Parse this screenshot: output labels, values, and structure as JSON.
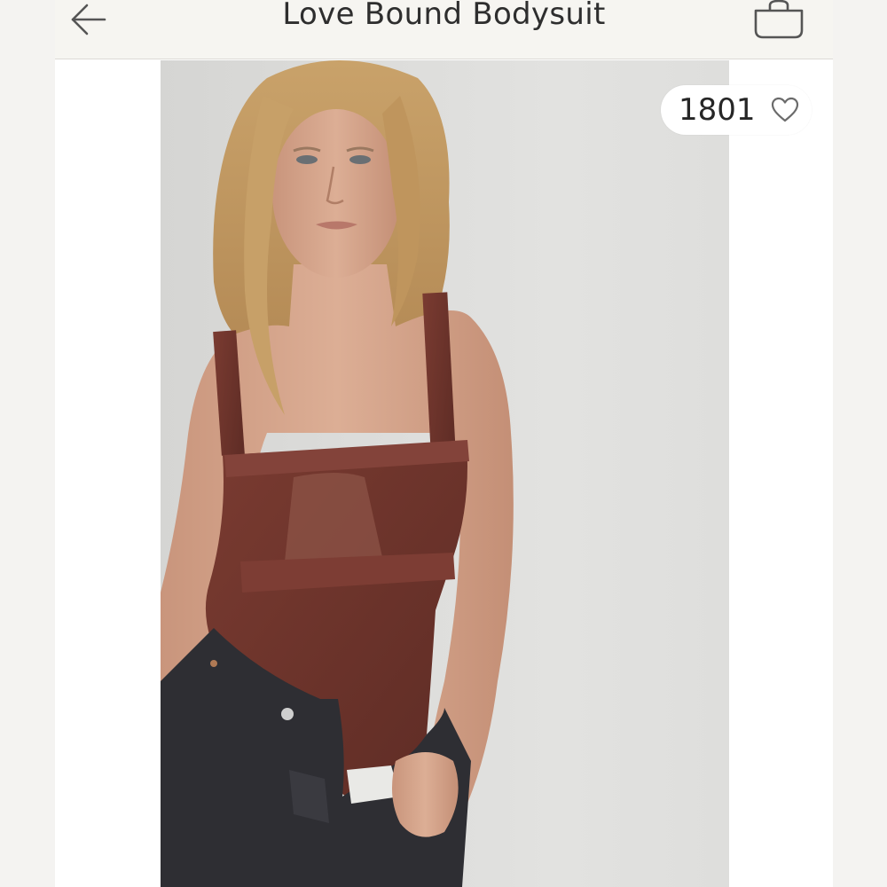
{
  "header": {
    "title": "Love Bound Bodysuit",
    "back_icon": "arrow-left-icon",
    "bag_icon": "shopping-bag-icon"
  },
  "product": {
    "likes": "1801",
    "like_icon": "heart-outline-icon",
    "colors": {
      "bodysuit": "#6e342c",
      "jeans": "#2e2e33",
      "background": "#dcdcda"
    }
  }
}
